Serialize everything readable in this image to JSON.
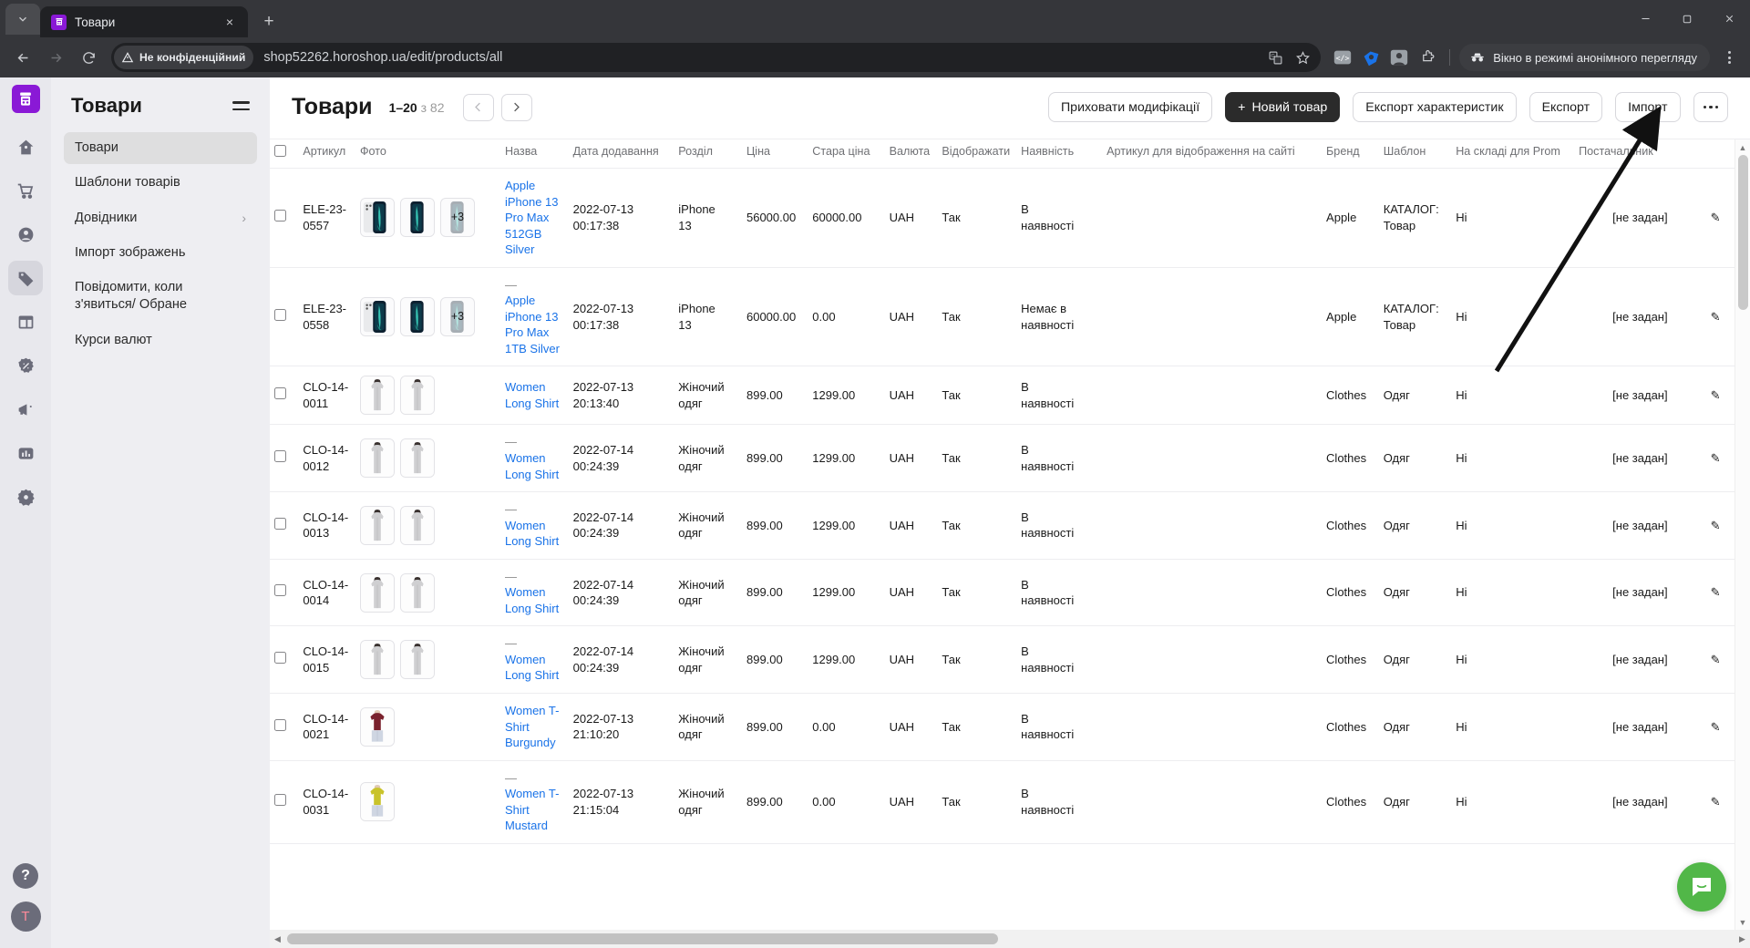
{
  "browser": {
    "tab": {
      "title": "Товари",
      "favicon": "shop-cart-icon",
      "close": "×"
    },
    "new_tab": "+",
    "tabstrip_chevron": "chevron-down-icon",
    "nav": {
      "back": "back-arrow-icon",
      "forward": "forward-arrow-icon",
      "reload": "reload-icon"
    },
    "security_label": "Не конфіденційний",
    "url": "shop52262.horoshop.ua/edit/products/all",
    "omni_icons": [
      "translate-icon",
      "bookmark-star-icon"
    ],
    "extensions": [
      "code-extension-icon",
      "tag-extension-icon",
      "user-extension-icon",
      "puzzle-extension-icon"
    ],
    "incognito_label": "Вікно в режимі анонімного перегляду",
    "menu": "chrome-menu-icon",
    "window_controls": {
      "minimize": "–",
      "maximize": "▢",
      "close": "✕"
    }
  },
  "rail": {
    "logo": "horoshop-logo",
    "items": [
      {
        "icon": "home-icon",
        "active": false
      },
      {
        "icon": "cart-icon",
        "active": false
      },
      {
        "icon": "user-icon",
        "active": false
      },
      {
        "icon": "tag-icon",
        "active": true
      },
      {
        "icon": "layout-icon",
        "active": false
      },
      {
        "icon": "percent-icon",
        "active": false
      },
      {
        "icon": "megaphone-icon",
        "active": false
      },
      {
        "icon": "chart-icon",
        "active": false
      },
      {
        "icon": "gear-icon",
        "active": false
      }
    ],
    "help": "?",
    "avatar": "T"
  },
  "sidebar": {
    "title": "Товари",
    "toggle": "hamburger-icon",
    "items": [
      {
        "label": "Товари",
        "active": true,
        "chevron": ""
      },
      {
        "label": "Шаблони товарів",
        "active": false,
        "chevron": ""
      },
      {
        "label": "Довідники",
        "active": false,
        "chevron": "›"
      },
      {
        "label": "Імпорт зображень",
        "active": false,
        "chevron": ""
      },
      {
        "label": "Повідомити, коли з'явиться/ Обране",
        "active": false,
        "chevron": ""
      },
      {
        "label": "Курси валют",
        "active": false,
        "chevron": ""
      }
    ]
  },
  "header": {
    "title": "Товари",
    "range": "1–20",
    "of_word": "з",
    "total": "82",
    "prev": "‹",
    "next": "›",
    "buttons": {
      "hide_modifications": "Приховати модифікації",
      "new_product": "Новий товар",
      "new_product_plus": "+",
      "export_attributes": "Експорт характеристик",
      "export": "Експорт",
      "import": "Імпорт",
      "more": "•••"
    }
  },
  "table": {
    "columns": [
      "",
      "Артикул",
      "Фото",
      "Назва",
      "Дата додавання",
      "Розділ",
      "Ціна",
      "Стара ціна",
      "Валюта",
      "Відображати",
      "Наявність",
      "Артикул для відображення на сайті",
      "Бренд",
      "Шаблон",
      "На складі для Prom",
      "Постачальник",
      ""
    ],
    "rows": [
      {
        "sku": "ELE-23-0557",
        "photos": 2,
        "photo_kind": "phone",
        "more_badge": "+3",
        "dash": "",
        "name": "Apple iPhone 13 Pro Max 512GB Silver",
        "date": "2022-07-13 00:17:38",
        "section": "iPhone 13",
        "price": "56000.00",
        "old_price": "60000.00",
        "currency": "UAH",
        "show": "Так",
        "availability": "В наявності",
        "site_sku": "",
        "brand": "Apple",
        "template": "КАТАЛОГ: Товар",
        "prom": "Ні",
        "supplier": "[не задан]",
        "edit": "✎"
      },
      {
        "sku": "ELE-23-0558",
        "photos": 2,
        "photo_kind": "phone",
        "more_badge": "+3",
        "dash": "—",
        "name": "Apple iPhone 13 Pro Max 1TB Silver",
        "date": "2022-07-13 00:17:38",
        "section": "iPhone 13",
        "price": "60000.00",
        "old_price": "0.00",
        "currency": "UAH",
        "show": "Так",
        "availability": "Немає в наявності",
        "site_sku": "",
        "brand": "Apple",
        "template": "КАТАЛОГ: Товар",
        "prom": "Ні",
        "supplier": "[не задан]",
        "edit": "✎"
      },
      {
        "sku": "CLO-14-0011",
        "photos": 2,
        "photo_kind": "dress-grey",
        "more_badge": "",
        "dash": "",
        "name": "Women Long Shirt",
        "date": "2022-07-13 20:13:40",
        "section": "Жіночий одяг",
        "price": "899.00",
        "old_price": "1299.00",
        "currency": "UAH",
        "show": "Так",
        "availability": "В наявності",
        "site_sku": "",
        "brand": "Clothes",
        "template": "Одяг",
        "prom": "Ні",
        "supplier": "[не задан]",
        "edit": "✎"
      },
      {
        "sku": "CLO-14-0012",
        "photos": 2,
        "photo_kind": "dress-grey",
        "more_badge": "",
        "dash": "—",
        "name": "Women Long Shirt",
        "date": "2022-07-14 00:24:39",
        "section": "Жіночий одяг",
        "price": "899.00",
        "old_price": "1299.00",
        "currency": "UAH",
        "show": "Так",
        "availability": "В наявності",
        "site_sku": "",
        "brand": "Clothes",
        "template": "Одяг",
        "prom": "Ні",
        "supplier": "[не задан]",
        "edit": "✎"
      },
      {
        "sku": "CLO-14-0013",
        "photos": 2,
        "photo_kind": "dress-grey",
        "more_badge": "",
        "dash": "—",
        "name": "Women Long Shirt",
        "date": "2022-07-14 00:24:39",
        "section": "Жіночий одяг",
        "price": "899.00",
        "old_price": "1299.00",
        "currency": "UAH",
        "show": "Так",
        "availability": "В наявності",
        "site_sku": "",
        "brand": "Clothes",
        "template": "Одяг",
        "prom": "Ні",
        "supplier": "[не задан]",
        "edit": "✎"
      },
      {
        "sku": "CLO-14-0014",
        "photos": 2,
        "photo_kind": "dress-grey",
        "more_badge": "",
        "dash": "—",
        "name": "Women Long Shirt",
        "date": "2022-07-14 00:24:39",
        "section": "Жіночий одяг",
        "price": "899.00",
        "old_price": "1299.00",
        "currency": "UAH",
        "show": "Так",
        "availability": "В наявності",
        "site_sku": "",
        "brand": "Clothes",
        "template": "Одяг",
        "prom": "Ні",
        "supplier": "[не задан]",
        "edit": "✎"
      },
      {
        "sku": "CLO-14-0015",
        "photos": 2,
        "photo_kind": "dress-grey",
        "more_badge": "",
        "dash": "—",
        "name": "Women Long Shirt",
        "date": "2022-07-14 00:24:39",
        "section": "Жіночий одяг",
        "price": "899.00",
        "old_price": "1299.00",
        "currency": "UAH",
        "show": "Так",
        "availability": "В наявності",
        "site_sku": "",
        "brand": "Clothes",
        "template": "Одяг",
        "prom": "Ні",
        "supplier": "[не задан]",
        "edit": "✎"
      },
      {
        "sku": "CLO-14-0021",
        "photos": 1,
        "photo_kind": "tshirt-burgundy",
        "more_badge": "",
        "dash": "",
        "name": "Women T-Shirt Burgundy",
        "date": "2022-07-13 21:10:20",
        "section": "Жіночий одяг",
        "price": "899.00",
        "old_price": "0.00",
        "currency": "UAH",
        "show": "Так",
        "availability": "В наявності",
        "site_sku": "",
        "brand": "Clothes",
        "template": "Одяг",
        "prom": "Ні",
        "supplier": "[не задан]",
        "edit": "✎"
      },
      {
        "sku": "CLO-14-0031",
        "photos": 1,
        "photo_kind": "tshirt-mustard",
        "more_badge": "",
        "dash": "—",
        "name": "Women T-Shirt Mustard",
        "date": "2022-07-13 21:15:04",
        "section": "Жіночий одяг",
        "price": "899.00",
        "old_price": "0.00",
        "currency": "UAH",
        "show": "Так",
        "availability": "В наявності",
        "site_sku": "",
        "brand": "Clothes",
        "template": "Одяг",
        "prom": "Ні",
        "supplier": "[не задан]",
        "edit": "✎"
      }
    ]
  },
  "chat": {
    "icon": "chat-bubble-icon",
    "color": "#51b748"
  },
  "annotation": {
    "type": "arrow",
    "points_to": "Імпорт"
  },
  "colors": {
    "accent": "#8a19d6",
    "link": "#1a73e8",
    "chrome_bg": "#35363a",
    "rail_bg": "#e8e8ed",
    "sidebar_bg": "#eeeef2"
  }
}
